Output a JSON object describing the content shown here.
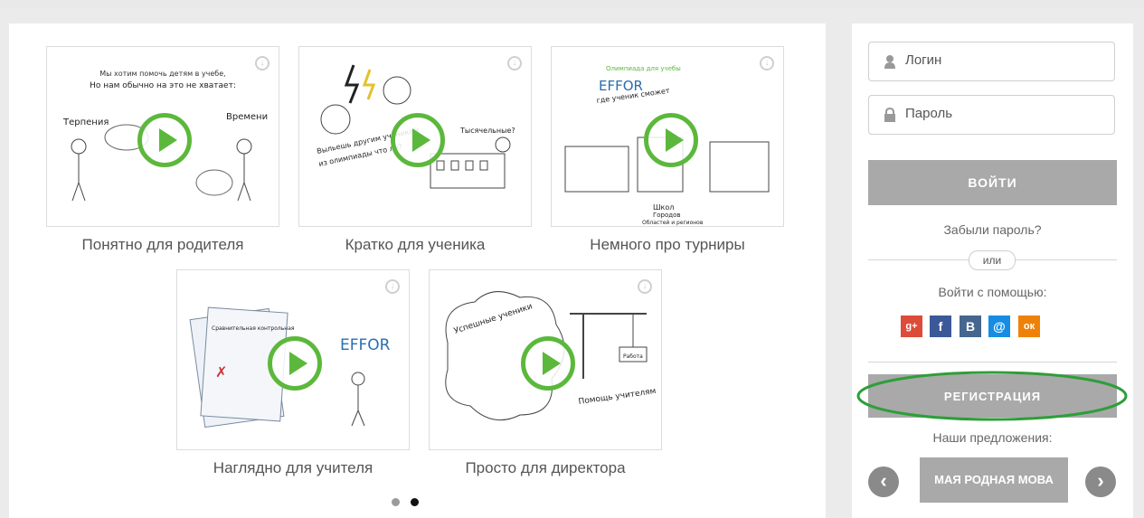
{
  "videos": [
    {
      "label": "Понятно для родителя",
      "icon": "play-icon"
    },
    {
      "label": "Кратко для ученика",
      "icon": "play-icon"
    },
    {
      "label": "Немного про турниры",
      "icon": "play-icon"
    },
    {
      "label": "Наглядно для учителя",
      "icon": "play-icon"
    },
    {
      "label": "Просто для директора",
      "icon": "play-icon"
    }
  ],
  "thumb_text": {
    "t1_line1": "Мы хотим помочь детям в учебе,",
    "t1_line2": "Но нам обычно на это не хватает:",
    "t1_left": "Терпения",
    "t1_right": "Времени",
    "t2_mid": "Выльешь другим ученикам",
    "t2_mid2": "из олимпиады что ли?",
    "t2_right": "Тысячельные?",
    "t3_top": "Олимпиада для учебы",
    "t3_brand": "EFFOR",
    "t3_sub": "где ученик сможет",
    "t3_b1": "Школ",
    "t3_b2": "Городов",
    "t3_b3": "Областей и регионов",
    "t4_sheet": "Сравнительная контрольная",
    "t4_brand": "EFFOR",
    "t5_left": "Успешные ученики",
    "t5_right": "Помощь учителям",
    "t5_sign": "Работа"
  },
  "carousel": {
    "active_index": 2
  },
  "login": {
    "login_placeholder": "Логин",
    "password_placeholder": "Пароль",
    "submit_label": "ВОЙТИ",
    "forgot_label": "Забыли пароль?",
    "or_label": "или",
    "social_label": "Войти с помощью:",
    "social": [
      {
        "name": "google-plus",
        "glyph": "g+",
        "color": "#dd4b39"
      },
      {
        "name": "facebook",
        "glyph": "f",
        "color": "#3b5998"
      },
      {
        "name": "vkontakte",
        "glyph": "B",
        "color": "#45668e"
      },
      {
        "name": "mail-ru",
        "glyph": "@",
        "color": "#168de2"
      },
      {
        "name": "odnoklassniki",
        "glyph": "ок",
        "color": "#ee8208"
      }
    ],
    "register_label": "РЕГИСТРАЦИЯ",
    "offers_label": "Наши предложения:",
    "offer_item": "МАЯ РОДНАЯ МОВА"
  },
  "colors": {
    "accent": "#5cb83c",
    "button": "#a9a9a9",
    "highlight": "#2e9e3a"
  }
}
